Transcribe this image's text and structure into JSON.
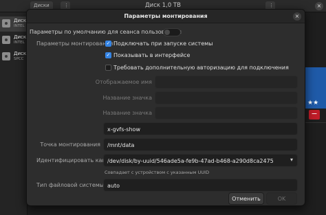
{
  "background_window": {
    "title": "Диск 1,0 ТВ",
    "left_button": "Диски",
    "close_symbol": "×",
    "disks": [
      {
        "name": "Диск",
        "sub": "INTEL"
      },
      {
        "name": "Диск",
        "sub": "INTEL"
      },
      {
        "name": "Диск",
        "sub": "SPCC"
      }
    ],
    "stars": "★★",
    "minus": "−"
  },
  "dialog": {
    "title": "Параметры монтирования",
    "close_symbol": "×",
    "session_default_label": "Параметры по умолчанию для сеанса пользователя",
    "session_default_on": false,
    "mount_options_label": "Параметры монтирования",
    "checkboxes": [
      {
        "label": "Подключать при запуске системы",
        "checked": true
      },
      {
        "label": "Показывать в интерфейсе",
        "checked": true
      },
      {
        "label": "Требовать дополнительную авторизацию для подключения",
        "checked": false
      }
    ],
    "check_mark": "✓",
    "display_name_label": "Отображаемое имя",
    "display_name_value": "",
    "icon_name_label": "Название значка",
    "icon_name_value": "",
    "symbolic_icon_label": "Название значка",
    "symbolic_icon_value": "",
    "options_value": "x-gvfs-show",
    "mount_point_label": "Точка монтирования",
    "mount_point_value": "/mnt/data",
    "identify_as_label": "Идентифицировать как",
    "identify_as_value": "/dev/disk/by-uuid/546ade5a-fe9b-47ad-b468-a290d8ca2475",
    "dropdown_arrow": "▾",
    "identify_note": "Совпадает с устройством с указанным UUID",
    "fs_type_label": "Тип файловой системы",
    "fs_type_value": "auto",
    "cancel_label": "Отменить",
    "ok_label": "OK"
  },
  "colors": {
    "accent": "#3584e4",
    "destructive": "#c01c28",
    "selection_blue": "#1f5aa8"
  }
}
